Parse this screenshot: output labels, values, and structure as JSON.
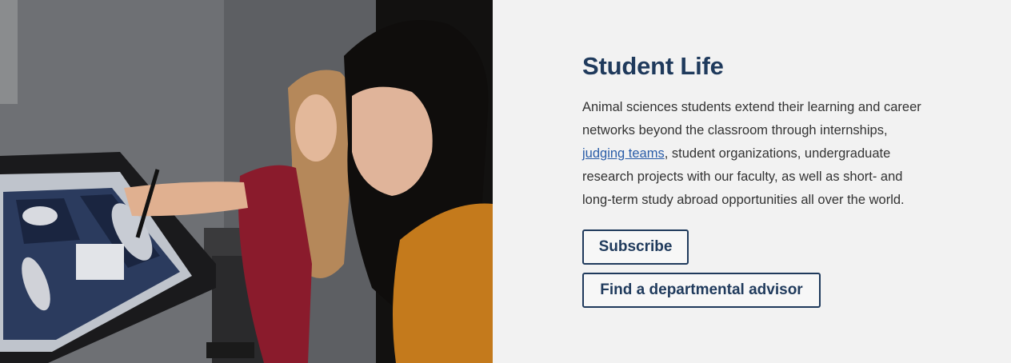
{
  "image": {
    "alt_icon": "photo-students-at-screen"
  },
  "section": {
    "title": "Student Life",
    "body_before": "Animal sciences students extend their learning and career networks beyond the classroom through internships, ",
    "link_text": "judging teams",
    "body_after": ", student organizations, undergraduate research projects with our faculty, as well as short- and long-term study abroad opportunities all over the world."
  },
  "buttons": {
    "subscribe": "Subscribe",
    "advisor": "Find a departmental advisor"
  },
  "colors": {
    "accent": "#1f3a5c",
    "link": "#2a5da8",
    "background": "#f2f2f2"
  }
}
